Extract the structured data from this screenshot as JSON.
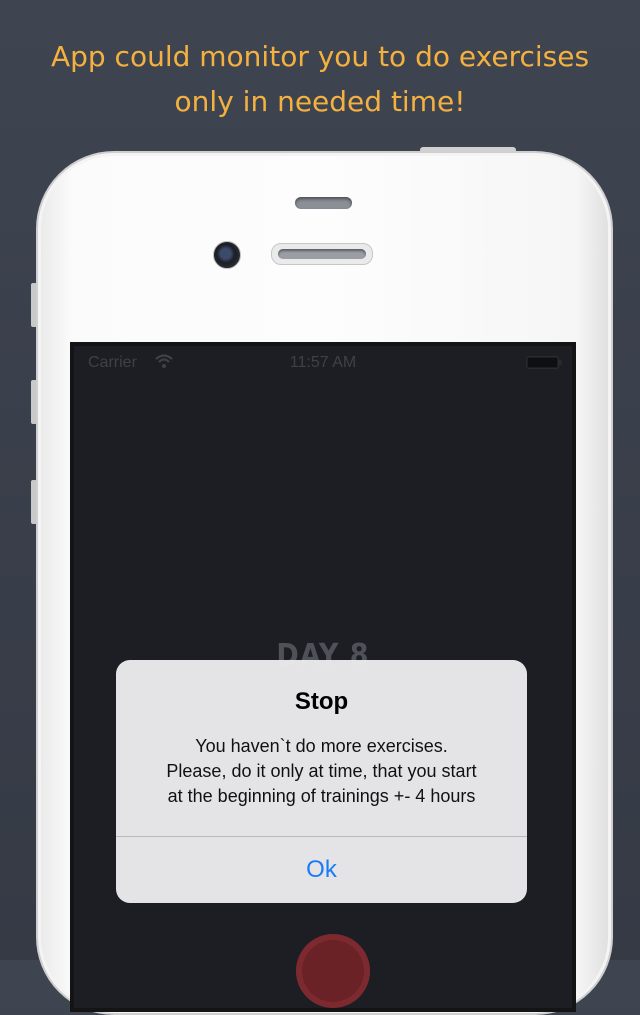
{
  "headline": {
    "line1": "App could monitor you to do exercises",
    "line2": "only in needed time!"
  },
  "status_bar": {
    "carrier": "Carrier",
    "time": "11:57 AM",
    "wifi_icon": "wifi-icon",
    "battery_icon": "battery-icon"
  },
  "screen": {
    "day_label": "DAY 8"
  },
  "alert": {
    "title": "Stop",
    "message_line1": "You haven`t do more exercises.",
    "message_line2": "Please, do it only at time, that you start",
    "message_line3": "at the beginning of trainings +- 4 hours",
    "ok_label": "Ok",
    "ok_color": "#1a7cf5"
  },
  "colors": {
    "headline": "#f4b13f",
    "background": "#3b404b",
    "screen_background": "#1d1e23"
  }
}
